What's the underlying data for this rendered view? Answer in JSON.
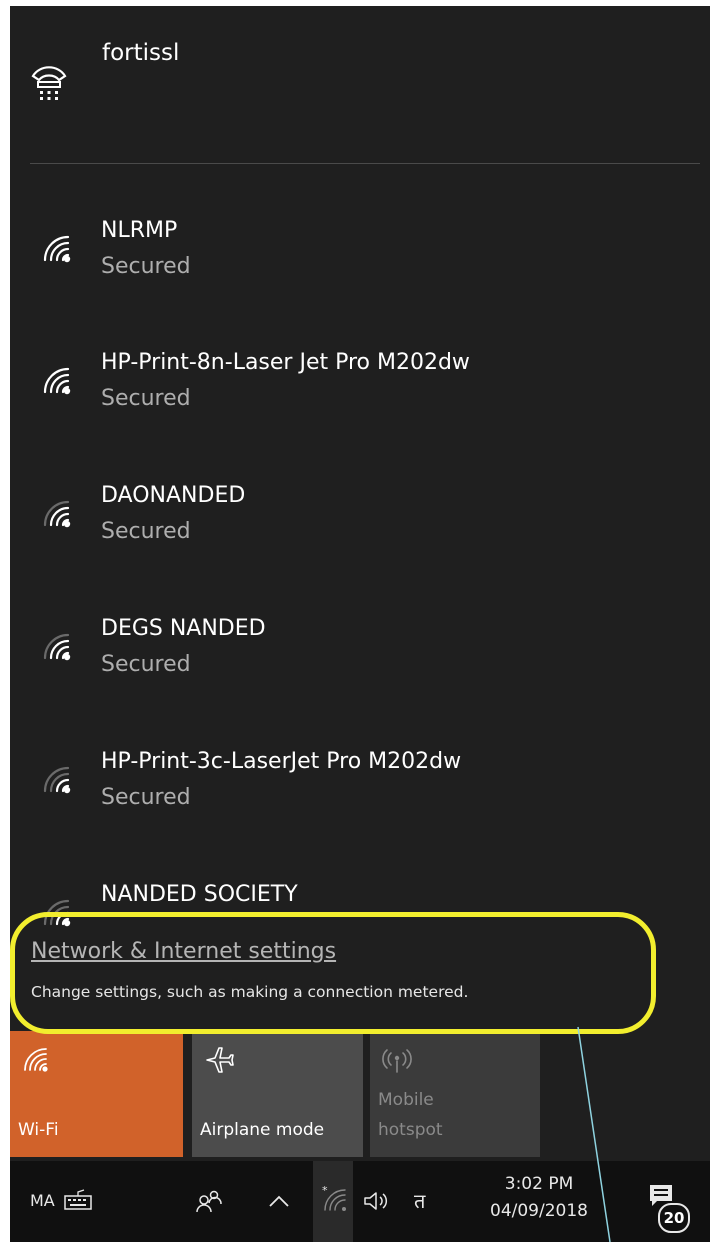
{
  "vpn": {
    "name": "fortissl",
    "icon": "vpn-icon"
  },
  "networks": [
    {
      "name": "NLRMP",
      "status": "Secured",
      "signal": "strong",
      "icon": "wifi-secured-icon"
    },
    {
      "name": "HP-Print-8n-Laser Jet Pro M202dw",
      "status": "Secured",
      "signal": "strong",
      "icon": "wifi-secured-icon"
    },
    {
      "name": "DAONANDED",
      "status": "Secured",
      "signal": "medium",
      "icon": "wifi-secured-icon"
    },
    {
      "name": "DEGS NANDED",
      "status": "Secured",
      "signal": "medium",
      "icon": "wifi-secured-icon"
    },
    {
      "name": "HP-Print-3c-LaserJet Pro M202dw",
      "status": "Secured",
      "signal": "weak",
      "icon": "wifi-secured-icon"
    },
    {
      "name": "NANDED SOCIETY",
      "status": "",
      "signal": "weak",
      "icon": "wifi-secured-icon"
    }
  ],
  "settings": {
    "link": "Network & Internet settings",
    "description": "Change settings, such as making a connection metered."
  },
  "quick_actions": [
    {
      "label": "Wi-Fi",
      "icon": "wifi-icon",
      "active": true,
      "color": "#d1622a"
    },
    {
      "label": "Airplane mode",
      "icon": "airplane-icon",
      "active": false,
      "color": "#4c4c4c"
    },
    {
      "label": "Mobile hotspot",
      "label_lines": [
        "Mobile",
        "hotspot"
      ],
      "icon": "hotspot-icon",
      "active": false,
      "disabled": true,
      "color": "#3b3b3b"
    }
  ],
  "taskbar": {
    "language": "MA",
    "ime_mode": "त",
    "time": "3:02 PM",
    "date": "04/09/2018",
    "notifications_count": "20",
    "icons": [
      "keyboard-icon",
      "people-icon",
      "show-hidden-icons-chevron",
      "wifi-tray-icon",
      "volume-icon",
      "notification-center-icon"
    ]
  },
  "colors": {
    "panel_bg": "#1f1f1f",
    "accent": "#d1622a",
    "annotation_highlight": "#f2ee2e",
    "annotation_line": "#8fd3e0"
  }
}
